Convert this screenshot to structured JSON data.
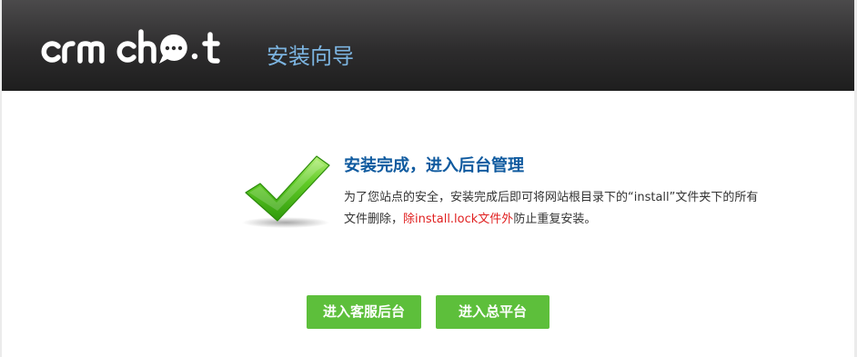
{
  "header": {
    "logo_text": "crm chat",
    "wizard_title": "安装向导"
  },
  "result": {
    "title": "安装完成，进入后台管理",
    "desc_part1": "为了您站点的安全，安装完成后即可将网站根目录下的“install”文件夹下的所有文件删除，",
    "desc_warning": "除install.lock文件外",
    "desc_part2": "防止重复安装。",
    "check_icon_color": "#4fbf1f"
  },
  "actions": {
    "service_backend_label": "进入客服后台",
    "main_platform_label": "进入总平台",
    "button_color": "#5dbf3b"
  }
}
